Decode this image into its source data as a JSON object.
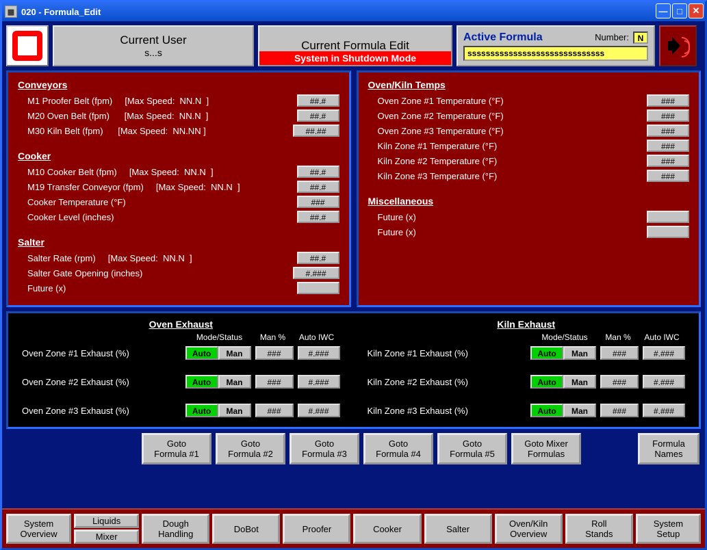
{
  "window_title": "020 - Formula_Edit",
  "user_panel": {
    "title": "Current User",
    "name": "s...s"
  },
  "formula_panel": {
    "title": "Current Formula Edit",
    "status": "System in Shutdown Mode"
  },
  "active_panel": {
    "title": "Active Formula",
    "num_label": "Number:",
    "num": "N",
    "text": "ssssssssssssssssssssssssssssss"
  },
  "left": {
    "conveyors": {
      "title": "Conveyors",
      "items": [
        {
          "label": "M1 Proofer Belt (fpm)     [Max Speed:  NN.N  ]",
          "val": "##.#"
        },
        {
          "label": "M20 Oven Belt (fpm)      [Max Speed:  NN.N  ]",
          "val": "##.#"
        },
        {
          "label": "M30 Kiln Belt (fpm)      [Max Speed:  NN.NN ]",
          "val": "##.##"
        }
      ]
    },
    "cooker": {
      "title": "Cooker",
      "items": [
        {
          "label": "M10 Cooker Belt (fpm)     [Max Speed:  NN.N  ]",
          "val": "##.#"
        },
        {
          "label": "M19 Transfer Conveyor (fpm)     [Max Speed:  NN.N  ]",
          "val": "##.#"
        },
        {
          "label": "Cooker Temperature (°F)",
          "val": "###"
        },
        {
          "label": "Cooker Level (inches)",
          "val": "##.#"
        }
      ]
    },
    "salter": {
      "title": "Salter",
      "items": [
        {
          "label": "Salter Rate (rpm)     [Max Speed:  NN.N  ]",
          "val": "##.#"
        },
        {
          "label": "Salter Gate Opening (inches)",
          "val": "#.###"
        },
        {
          "label": "Future (x)",
          "val": ""
        }
      ]
    }
  },
  "right": {
    "oven": {
      "title": "Oven/Kiln Temps",
      "items": [
        {
          "label": "Oven Zone #1 Temperature (°F)",
          "val": "###"
        },
        {
          "label": "Oven Zone #2 Temperature (°F)",
          "val": "###"
        },
        {
          "label": "Oven Zone #3 Temperature (°F)",
          "val": "###"
        },
        {
          "label": "Kiln Zone #1 Temperature (°F)",
          "val": "###"
        },
        {
          "label": "Kiln Zone #2 Temperature (°F)",
          "val": "###"
        },
        {
          "label": "Kiln Zone #3 Temperature (°F)",
          "val": "###"
        }
      ]
    },
    "misc": {
      "title": "Miscellaneous",
      "items": [
        {
          "label": "Future (x)",
          "val": ""
        },
        {
          "label": "Future (x)",
          "val": ""
        }
      ]
    }
  },
  "exhaust": {
    "oven_title": "Oven Exhaust",
    "kiln_title": "Kiln Exhaust",
    "hdr": {
      "mode": "Mode/Status",
      "man": "Man %",
      "auto": "Auto IWC"
    },
    "auto": "Auto",
    "man": "Man",
    "oven": [
      {
        "label": "Oven Zone #1 Exhaust (%)",
        "man": "###",
        "auto": "#.###"
      },
      {
        "label": "Oven Zone #2 Exhaust (%)",
        "man": "###",
        "auto": "#.###"
      },
      {
        "label": "Oven Zone #3 Exhaust (%)",
        "man": "###",
        "auto": "#.###"
      }
    ],
    "kiln": [
      {
        "label": "Kiln Zone #1 Exhaust (%)",
        "man": "###",
        "auto": "#.###"
      },
      {
        "label": "Kiln Zone #2 Exhaust (%)",
        "man": "###",
        "auto": "#.###"
      },
      {
        "label": "Kiln Zone #3 Exhaust (%)",
        "man": "###",
        "auto": "#.###"
      }
    ]
  },
  "goto": [
    "Goto\nFormula #1",
    "Goto\nFormula #2",
    "Goto\nFormula #3",
    "Goto\nFormula #4",
    "Goto\nFormula #5",
    "Goto Mixer\nFormulas"
  ],
  "goto_names": "Formula\nNames",
  "nav": {
    "system_overview": "System\nOverview",
    "liquids": "Liquids",
    "mixer": "Mixer",
    "dough": "Dough\nHandling",
    "dobot": "DoBot",
    "proofer": "Proofer",
    "cooker": "Cooker",
    "salter": "Salter",
    "oven": "Oven/Kiln\nOverview",
    "roll": "Roll\nStands",
    "setup": "System\nSetup"
  }
}
